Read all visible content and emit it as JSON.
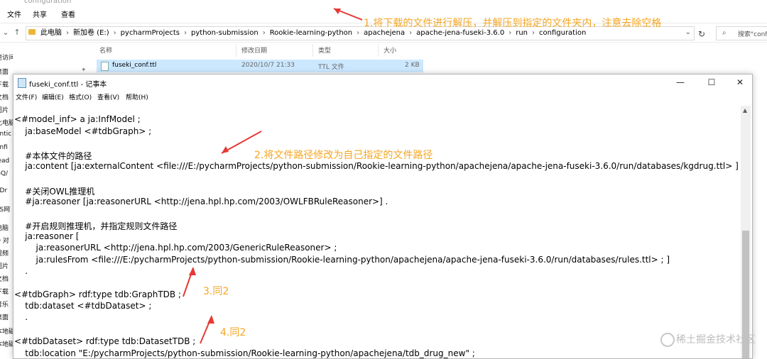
{
  "explorer": {
    "title": "configuration",
    "ribbon": [
      "文件",
      "共享",
      "查看"
    ],
    "breadcrumbs": [
      "此电脑",
      "新加卷 (E:)",
      "pycharmProjects",
      "python-submission",
      "Rookie-learning-python",
      "apachejena",
      "apache-jena-fuseki-3.6.0",
      "run",
      "configuration"
    ],
    "search_placeholder": "搜索\"conf",
    "columns": [
      "名称",
      "修改日期",
      "类型",
      "大小"
    ],
    "file": {
      "name": "fuseki_conf.ttl",
      "date": "2020/10/7 21:33",
      "type": "TTL 文件",
      "size": "2 KB"
    },
    "sidebar_items": [
      "速访问",
      "桌面",
      "下载",
      "文档",
      "图片",
      "此电脑",
      "antic",
      "onfi",
      "lead",
      "GQ/",
      "eDr",
      "PS网",
      "电脑",
      "D 对",
      "视频",
      "图片",
      "文档",
      "下载",
      "音乐",
      "桌面",
      "本地磁",
      "本地磁"
    ]
  },
  "notepad": {
    "title": "fuseki_conf.ttl - 记事本",
    "menu": [
      "文件(F)",
      "编辑(E)",
      "格式(O)",
      "查看(V)",
      "帮助(H)"
    ],
    "lines": [
      "<#model_inf> a ja:InfModel ;",
      "    ja:baseModel <#tdbGraph> ;",
      "",
      "    #本体文件的路径",
      "    ja:content [ja:externalContent <file:///E:/pycharmProjects/python-submission/Rookie-learning-python/apachejena/apache-jena-fuseki-3.6.0/run/databases/kgdrug.ttl> ] ;",
      "",
      "    #关闭OWL推理机",
      "    #ja:reasoner [ja:reasonerURL <http://jena.hpl.hp.com/2003/OWLFBRuleReasoner>] .",
      "",
      "    #开启规则推理机，并指定规则文件路径",
      "    ja:reasoner [",
      "        ja:reasonerURL <http://jena.hpl.hp.com/2003/GenericRuleReasoner> ;",
      "        ja:rulesFrom <file:///E:/pycharmProjects/python-submission/Rookie-learning-python/apachejena/apache-jena-fuseki-3.6.0/run/databases/rules.ttl> ; ]",
      "    .",
      "",
      "<#tdbGraph> rdf:type tdb:GraphTDB ;",
      "    tdb:dataset <#tdbDataset> ;",
      "    .",
      "",
      "<#tdbDataset> rdf:type tdb:DatasetTDB ;",
      "    tdb:location \"E:/pycharmProjects/python-submission/Rookie-learning-python/apachejena/tdb_drug_new\" ;"
    ]
  },
  "annotations": [
    "1.将下载的文件进行解压，并解压到指定的文件夹内，注意去除空格",
    "2.将文件路径修改为自己指定的文件路径",
    "3.同2",
    "4.同2"
  ],
  "annotation_color": "#f5a623",
  "watermark": "稀土掘金技术社区"
}
